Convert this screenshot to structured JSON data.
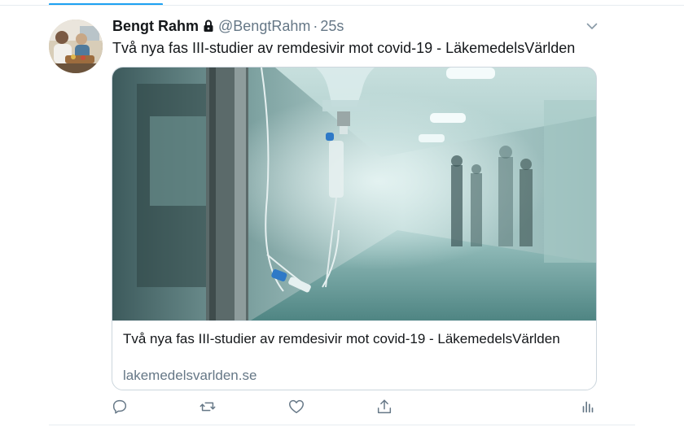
{
  "tweet": {
    "author": {
      "display_name": "Bengt Rahm",
      "handle": "@BengtRahm",
      "protected_icon": "lock-icon"
    },
    "separator": "·",
    "time": "25s",
    "text": "Två nya fas III-studier av remdesivir mot covid-19 - LäkemedelsVärlden",
    "menu_icon": "chevron-down-icon"
  },
  "card": {
    "image_subject": "iv-drip-hospital-corridor",
    "title": "Två nya fas III-studier av remdesivir mot covid-19 - LäkemedelsVärlden",
    "domain": "lakemedelsvarlden.se"
  },
  "actions": [
    {
      "name": "reply",
      "icon": "reply-icon"
    },
    {
      "name": "retweet",
      "icon": "retweet-icon"
    },
    {
      "name": "like",
      "icon": "heart-icon"
    },
    {
      "name": "share",
      "icon": "share-icon"
    },
    {
      "name": "analytics",
      "icon": "analytics-icon"
    }
  ],
  "colors": {
    "accent": "#1da1f2",
    "text": "#14171a",
    "secondary_text": "#657786",
    "icon": "#657786",
    "border": "#ccd6dd"
  }
}
